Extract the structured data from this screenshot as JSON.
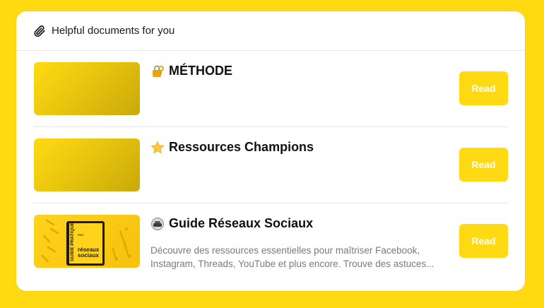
{
  "panel": {
    "heading": "Helpful documents for you",
    "heading_icon": "paperclip-icon"
  },
  "documents": [
    {
      "emoji_icon": "lock-key-icon",
      "title": "MÉTHODE",
      "description_lines": [],
      "button_label": "Read",
      "thumbnail": "yellow-gradient"
    },
    {
      "emoji_icon": "star-icon",
      "title": "Ressources Champions",
      "description_lines": [],
      "button_label": "Read",
      "thumbnail": "yellow-gradient"
    },
    {
      "emoji_icon": "phone-receiver-icon",
      "title": "Guide Réseaux Sociaux",
      "description_lines": [
        "Découvre des ressources essentielles pour maîtriser Facebook,",
        "Instagram, Threads, YouTube et plus encore. Trouve des astuces..."
      ],
      "button_label": "Read",
      "thumbnail": "guide-pratique-book-image",
      "thumbnail_text": {
        "vertical": "GUIDE PRATIQUE",
        "line1": "Mon",
        "line2": "réseaux",
        "line3": "sociaux"
      }
    }
  ],
  "colors": {
    "background": "#FFDA12",
    "button": "#FFDA12",
    "button_text": "#FFFFFF",
    "description": "#7A7A7A"
  }
}
